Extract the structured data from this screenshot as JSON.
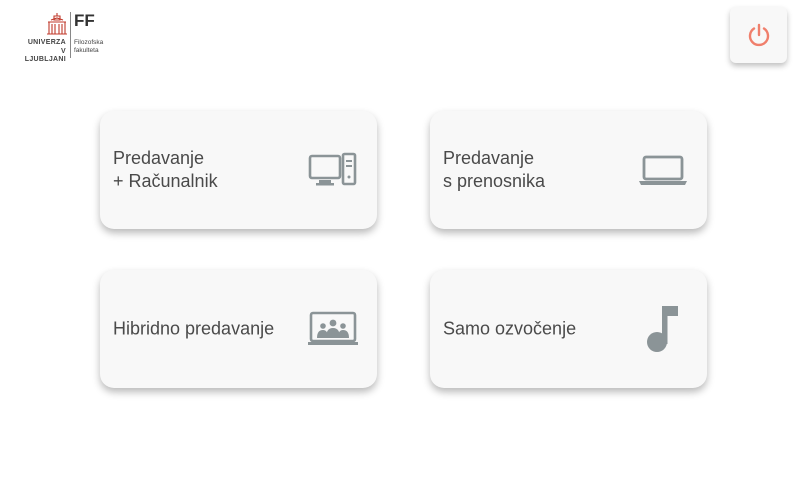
{
  "logo": {
    "university_line1": "UNIVERZA",
    "university_line2": "V LJUBLJANI",
    "faculty_abbr": "FF",
    "faculty_line1": "Filozofska",
    "faculty_line2": "fakulteta",
    "accent_color": "#c0392b"
  },
  "power_button": {
    "icon": "power-icon",
    "color": "#f07f6c"
  },
  "cards": [
    {
      "line1": "Predavanje",
      "line2": "+ Računalnik",
      "icon": "desktop-computer-icon"
    },
    {
      "line1": "Predavanje",
      "line2": "s prenosnika",
      "icon": "laptop-icon"
    },
    {
      "line1": "Hibridno predavanje",
      "icon": "video-conference-icon"
    },
    {
      "line1": "Samo ozvočenje",
      "icon": "music-note-icon"
    }
  ],
  "icon_color": "#8b9497"
}
